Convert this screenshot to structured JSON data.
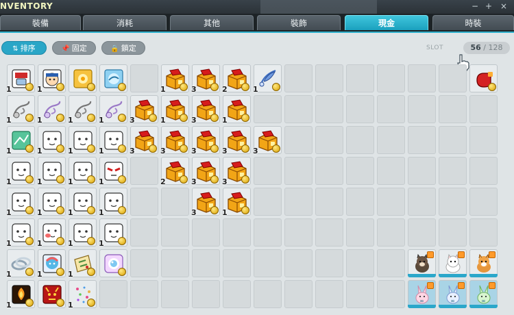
{
  "window": {
    "title": "NVENTORY",
    "min_glyph": "−",
    "max_glyph": "+",
    "close_glyph": "×"
  },
  "tabs": [
    {
      "label": "裝備",
      "active": false
    },
    {
      "label": "消耗",
      "active": false
    },
    {
      "label": "其他",
      "active": false
    },
    {
      "label": "裝飾",
      "active": false
    },
    {
      "label": "現金",
      "active": true
    },
    {
      "label": "時裝",
      "active": false
    }
  ],
  "toolbar": {
    "sort_label": "排序",
    "sort_icon": "sort-icon",
    "pin_label": "固定",
    "pin_icon": "pin-icon",
    "lock_label": "鎖定",
    "lock_icon": "lock-icon"
  },
  "slots": {
    "label": "SLOT",
    "used": "56",
    "separator": " / ",
    "total": "128"
  },
  "colors": {
    "accent": "#2aa6c7",
    "panel": "#dfe4e6",
    "coin": "#e8b400",
    "box": "#e89a10"
  },
  "grid": {
    "columns": 16,
    "rows": [
      [
        {
          "icon": "mask-item",
          "qty": "1"
        },
        {
          "icon": "face-sticker",
          "qty": "1"
        },
        {
          "icon": "yellow-scroll"
        },
        {
          "icon": "blue-scroll"
        },
        {},
        {
          "icon": "gold-box",
          "qty": "1"
        },
        {
          "icon": "gold-box",
          "qty": "3"
        },
        {
          "icon": "gold-box",
          "qty": "2"
        },
        {
          "icon": "blue-feather",
          "qty": "1"
        },
        {},
        {},
        {},
        {},
        {},
        {},
        {
          "icon": "red-glove"
        }
      ],
      [
        {
          "icon": "grey-whistle",
          "qty": "1"
        },
        {
          "icon": "purple-whistle",
          "qty": "1"
        },
        {
          "icon": "grey-whistle",
          "qty": "1"
        },
        {
          "icon": "purple-whistle",
          "qty": "1"
        },
        {
          "icon": "gold-box",
          "qty": "3"
        },
        {
          "icon": "gold-box",
          "qty": "1"
        },
        {
          "icon": "gold-box",
          "qty": "3"
        },
        {
          "icon": "gold-box",
          "qty": "1"
        },
        {},
        {},
        {},
        {},
        {},
        {},
        {},
        {}
      ],
      [
        {
          "icon": "green-card",
          "qty": "1"
        },
        {
          "icon": "white-face",
          "qty": "1"
        },
        {
          "icon": "white-face",
          "qty": "1"
        },
        {
          "icon": "white-face",
          "qty": "1"
        },
        {
          "icon": "gold-box",
          "qty": "3"
        },
        {
          "icon": "gold-box",
          "qty": "3"
        },
        {
          "icon": "gold-box",
          "qty": "3"
        },
        {
          "icon": "gold-box",
          "qty": "3"
        },
        {
          "icon": "gold-box",
          "qty": "3"
        },
        {},
        {},
        {},
        {},
        {},
        {},
        {}
      ],
      [
        {
          "icon": "white-face",
          "qty": "1"
        },
        {
          "icon": "white-face",
          "qty": "1"
        },
        {
          "icon": "white-face",
          "qty": "1"
        },
        {
          "icon": "red-eye-face",
          "qty": "1"
        },
        {},
        {
          "icon": "gold-box",
          "qty": "2"
        },
        {
          "icon": "gold-box",
          "qty": "3"
        },
        {
          "icon": "gold-box",
          "qty": "3"
        },
        {},
        {},
        {},
        {},
        {},
        {},
        {},
        {}
      ],
      [
        {
          "icon": "white-face",
          "qty": "1"
        },
        {
          "icon": "white-face",
          "qty": "1"
        },
        {
          "icon": "white-face",
          "qty": "1"
        },
        {
          "icon": "white-face",
          "qty": "1"
        },
        {},
        {},
        {
          "icon": "gold-box",
          "qty": "3"
        },
        {
          "icon": "gold-box",
          "qty": "1"
        },
        {},
        {},
        {},
        {},
        {},
        {},
        {},
        {}
      ],
      [
        {
          "icon": "white-face",
          "qty": "1"
        },
        {
          "icon": "red-cheek-face",
          "qty": "1"
        },
        {
          "icon": "white-face",
          "qty": "1"
        },
        {
          "icon": "white-face",
          "qty": "1"
        },
        {},
        {},
        {},
        {},
        {},
        {},
        {},
        {},
        {},
        {},
        {},
        {}
      ],
      [
        {
          "icon": "silver-ring",
          "qty": "1"
        },
        {
          "icon": "rainbow-hat",
          "qty": "1"
        },
        {
          "icon": "treasure-map",
          "qty": "1"
        },
        {
          "icon": "sparkle-ticket"
        },
        {},
        {},
        {},
        {},
        {},
        {},
        {},
        {},
        {},
        {
          "pet": "shiba-pet"
        },
        {
          "pet": "white-dog-pet"
        },
        {
          "pet": "orange-dog-pet"
        }
      ],
      [
        {
          "icon": "torch-item",
          "qty": "1"
        },
        {
          "icon": "red-demon"
        },
        {
          "icon": "sparkle-confetti",
          "qty": "1"
        },
        {},
        {},
        {},
        {},
        {},
        {},
        {},
        {},
        {},
        {},
        {
          "pet": "pink-bunny-pet",
          "inf": "∞"
        },
        {
          "pet": "blue-bunny-pet",
          "inf": "∞"
        },
        {
          "pet": "green-bunny-pet",
          "inf": "∞"
        }
      ]
    ]
  }
}
